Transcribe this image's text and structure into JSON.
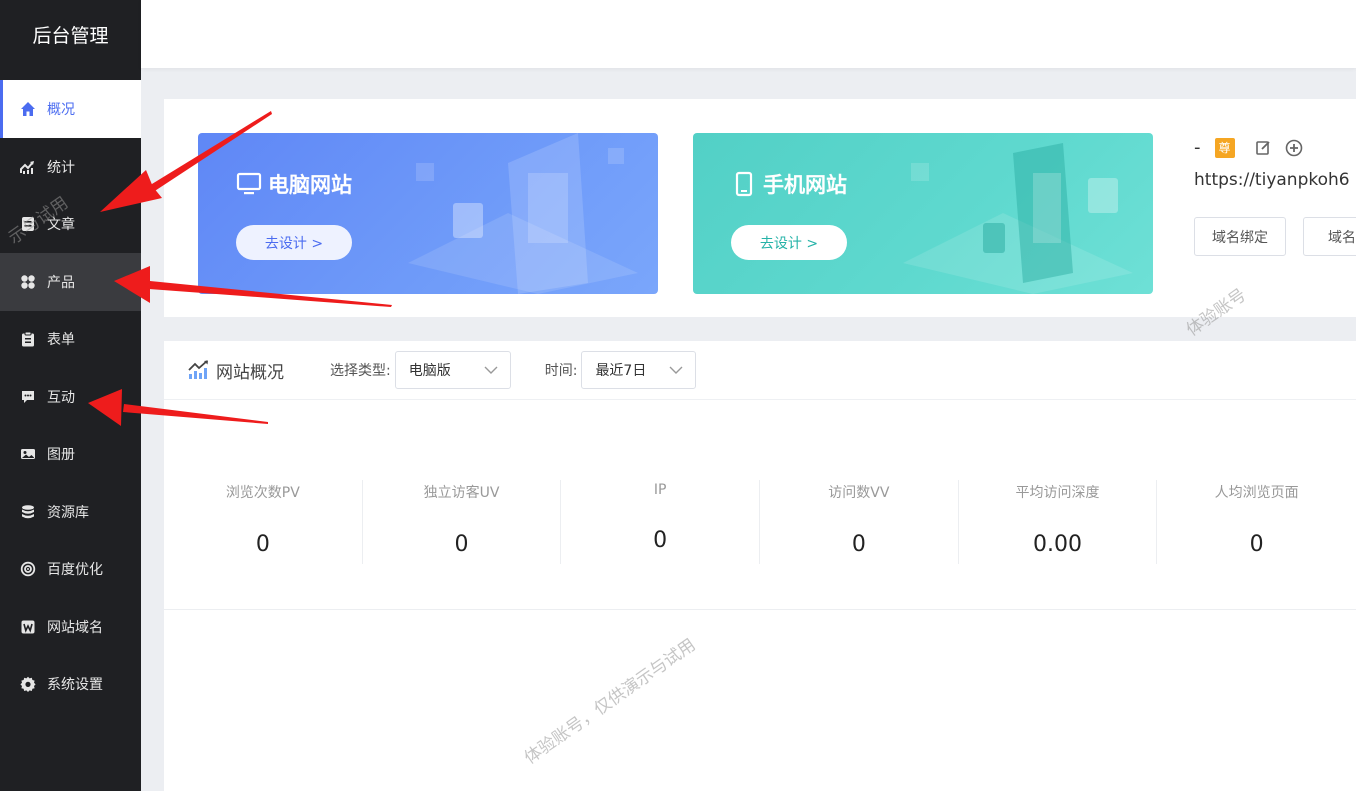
{
  "app": {
    "title": "后台管理"
  },
  "sidebar": {
    "items": [
      {
        "label": "概况",
        "icon": "home-icon",
        "active": true
      },
      {
        "label": "统计",
        "icon": "stats-chart-icon"
      },
      {
        "label": "文章",
        "icon": "article-icon"
      },
      {
        "label": "产品",
        "icon": "product-grid-icon",
        "hover": true
      },
      {
        "label": "表单",
        "icon": "clipboard-icon"
      },
      {
        "label": "互动",
        "icon": "chat-bubble-icon"
      },
      {
        "label": "图册",
        "icon": "album-icon"
      },
      {
        "label": "资源库",
        "icon": "database-icon"
      },
      {
        "label": "百度优化",
        "icon": "seo-target-icon"
      },
      {
        "label": "网站域名",
        "icon": "domain-w-icon"
      },
      {
        "label": "系统设置",
        "icon": "gear-icon"
      }
    ]
  },
  "cards": {
    "pc": {
      "title": "电脑网站",
      "button": "去设计 >"
    },
    "mobile": {
      "title": "手机网站",
      "button": "去设计 >"
    }
  },
  "account": {
    "name": "-",
    "badge": "尊",
    "url": "https://tiyanpkoh6",
    "buttons": [
      "域名绑定",
      "域名备"
    ]
  },
  "overview": {
    "title": "网站概况",
    "type_label": "选择类型:",
    "type_value": "电脑版",
    "time_label": "时间:",
    "time_value": "最近7日",
    "stats": [
      {
        "label": "浏览次数PV",
        "value": "0"
      },
      {
        "label": "独立访客UV",
        "value": "0"
      },
      {
        "label": "IP",
        "value": "0"
      },
      {
        "label": "访问数VV",
        "value": "0"
      },
      {
        "label": "平均访问深度",
        "value": "0.00"
      },
      {
        "label": "人均浏览页面",
        "value": "0"
      }
    ]
  },
  "watermark": {
    "text": "体验账号，仅供演示与试用",
    "text_short": "体验账号",
    "text_side": "示与试用"
  },
  "colors": {
    "accent": "#4b6cf0",
    "sidebar": "#1f2023",
    "pc_card": "#6f9bf9",
    "mobile_card": "#5fd9cf",
    "arrow": "#ee1c1c",
    "badge": "#f5a623"
  }
}
